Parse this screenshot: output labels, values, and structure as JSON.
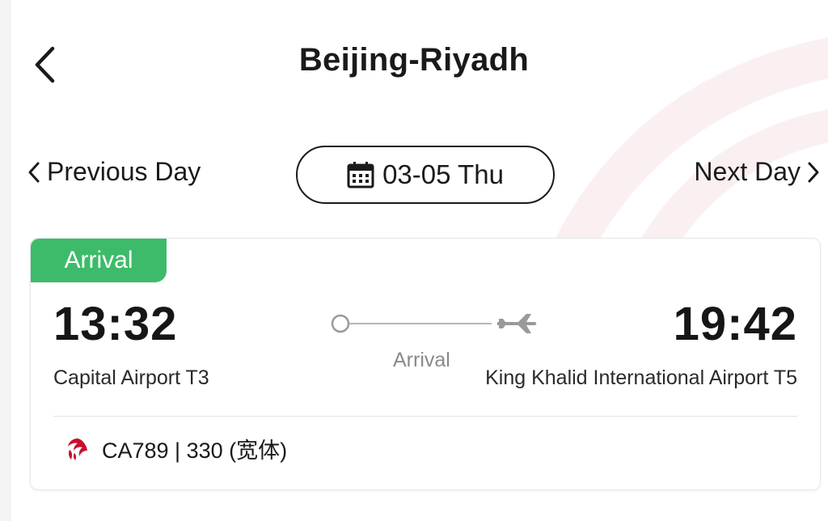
{
  "header": {
    "title": "Beijing-Riyadh",
    "back_icon": "chevron-left-icon"
  },
  "date_nav": {
    "previous_label": "Previous Day",
    "next_label": "Next Day",
    "date_label": "03-05 Thu",
    "calendar_icon": "calendar-icon"
  },
  "flight": {
    "status_badge": "Arrival",
    "status_color": "#3dbb6a",
    "departure_time": "13:32",
    "arrival_time": "19:42",
    "departure_airport": "Capital Airport T3",
    "arrival_airport": "King Khalid International Airport T5",
    "route_label": "Arrival",
    "flight_number_text": "CA789 | 330 (宽体)",
    "airline_logo_color": "#c8102e"
  }
}
